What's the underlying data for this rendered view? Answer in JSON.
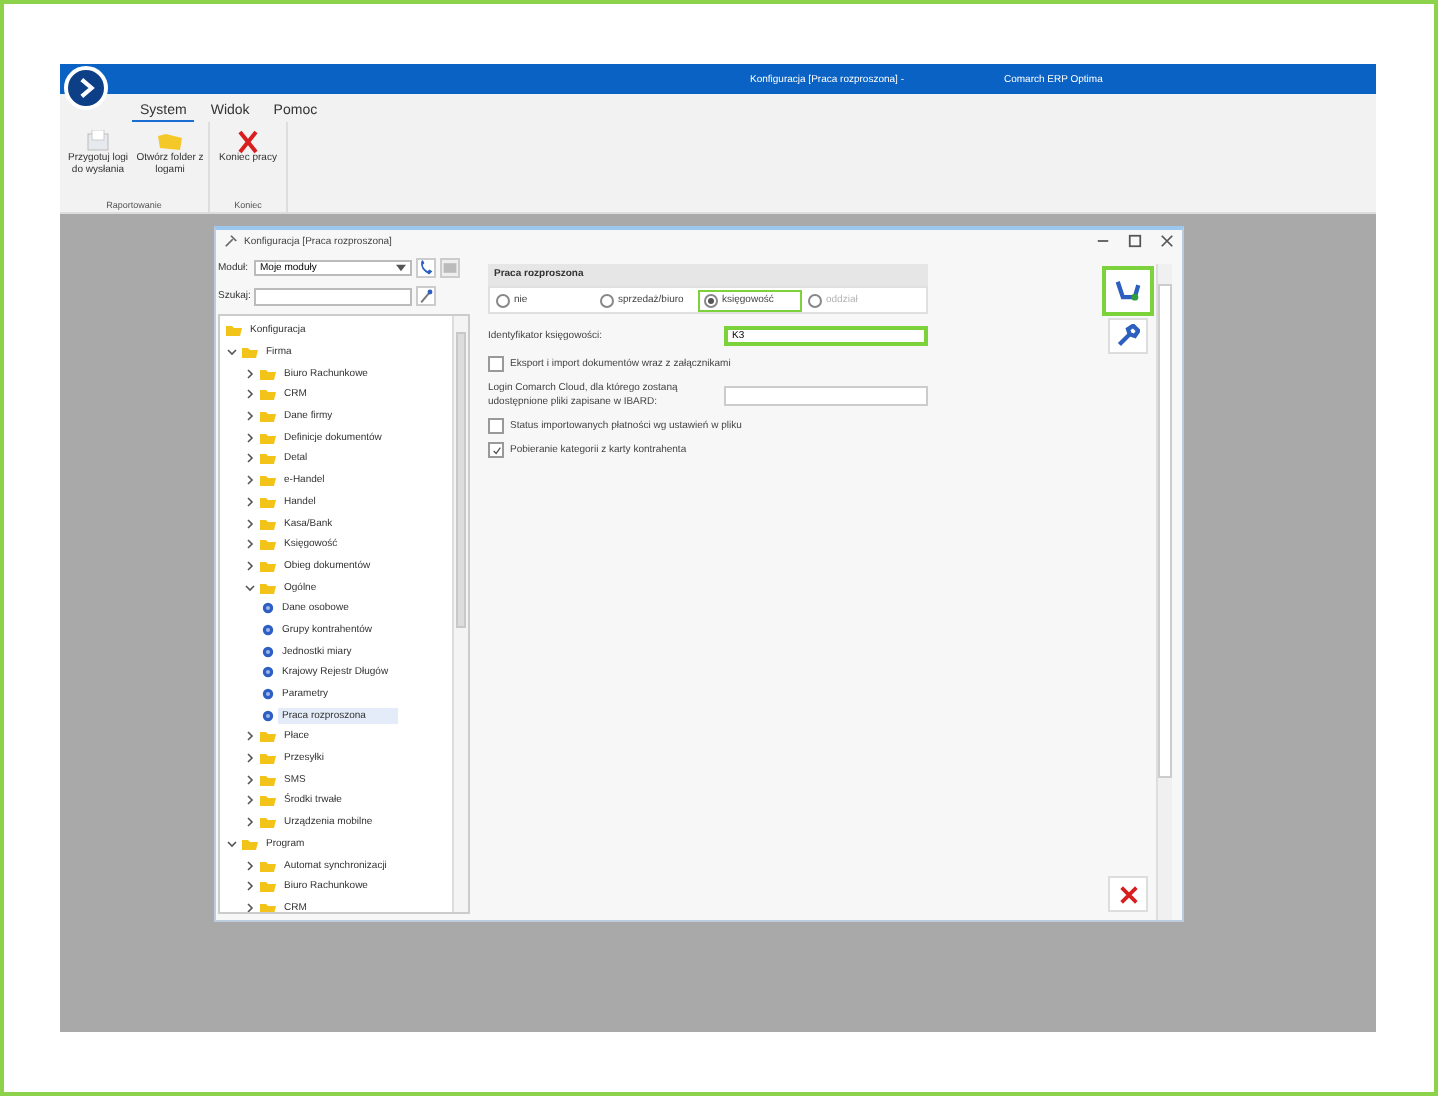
{
  "app_window": {
    "title": "Konfiguracja [Praca rozproszona] -",
    "app_name": "Comarch ERP Optima"
  },
  "ribbon": {
    "tabs": [
      {
        "label": "System",
        "selected": true
      },
      {
        "label": "Widok",
        "selected": false
      },
      {
        "label": "Pomoc",
        "selected": false
      }
    ],
    "groups": [
      {
        "label": "Raportowanie",
        "buttons": [
          {
            "label": "Przygotuj logi do wysłania",
            "kind": "logs"
          },
          {
            "label": "Otwórz folder z logami",
            "kind": "folder"
          }
        ]
      },
      {
        "label": "Koniec",
        "buttons": [
          {
            "label": "Koniec pracy",
            "kind": "exit"
          }
        ]
      }
    ]
  },
  "dialog": {
    "title": "Konfiguracja [Praca rozproszona]",
    "module_label": "Moduł:",
    "module_value": "Moje moduły",
    "search_label": "Szukaj:",
    "tree": [
      {
        "label": "Konfiguracja",
        "kind": "folder",
        "selected": false
      },
      {
        "label": "Firma",
        "kind": "folder",
        "expanded": true,
        "selected": false,
        "children": [
          {
            "label": "Biuro Rachunkowe",
            "kind": "folder",
            "expanded": false,
            "selected": false
          },
          {
            "label": "CRM",
            "kind": "folder",
            "expanded": false,
            "selected": false
          },
          {
            "label": "Dane firmy",
            "kind": "folder",
            "expanded": false,
            "selected": false
          },
          {
            "label": "Definicje dokumentów",
            "kind": "folder",
            "expanded": false,
            "selected": false
          },
          {
            "label": "Detal",
            "kind": "folder",
            "expanded": false,
            "selected": false
          },
          {
            "label": "e-Handel",
            "kind": "folder",
            "expanded": false,
            "selected": false
          },
          {
            "label": "Handel",
            "kind": "folder",
            "expanded": false,
            "selected": false
          },
          {
            "label": "Kasa/Bank",
            "kind": "folder",
            "expanded": false,
            "selected": false
          },
          {
            "label": "Księgowość",
            "kind": "folder",
            "expanded": false,
            "selected": false
          },
          {
            "label": "Obieg dokumentów",
            "kind": "folder",
            "expanded": false,
            "selected": false
          },
          {
            "label": "Ogólne",
            "kind": "folder",
            "expanded": true,
            "selected": false,
            "children": [
              {
                "label": "Dane osobowe",
                "kind": "setting",
                "selected": false
              },
              {
                "label": "Grupy kontrahentów",
                "kind": "setting",
                "selected": false
              },
              {
                "label": "Jednostki miary",
                "kind": "setting",
                "selected": false
              },
              {
                "label": "Krajowy Rejestr Długów",
                "kind": "setting",
                "selected": false
              },
              {
                "label": "Parametry",
                "kind": "setting",
                "selected": false
              },
              {
                "label": "Praca rozproszona",
                "kind": "setting",
                "selected": true
              }
            ]
          },
          {
            "label": "Płace",
            "kind": "folder",
            "expanded": false,
            "selected": false
          },
          {
            "label": "Przesyłki",
            "kind": "folder",
            "expanded": false,
            "selected": false
          },
          {
            "label": "SMS",
            "kind": "folder",
            "expanded": false,
            "selected": false
          },
          {
            "label": "Środki trwałe",
            "kind": "folder",
            "expanded": false,
            "selected": false
          },
          {
            "label": "Urządzenia mobilne",
            "kind": "folder",
            "expanded": false,
            "selected": false
          }
        ]
      },
      {
        "label": "Program",
        "kind": "folder",
        "expanded": true,
        "selected": false,
        "children": [
          {
            "label": "Automat synchronizacji",
            "kind": "folder",
            "expanded": false,
            "selected": false
          },
          {
            "label": "Biuro Rachunkowe",
            "kind": "folder",
            "expanded": false,
            "selected": false
          },
          {
            "label": "CRM",
            "kind": "folder",
            "expanded": false,
            "selected": false
          }
        ]
      }
    ],
    "section_title": "Praca rozproszona",
    "radios": [
      {
        "label": "nie",
        "selected": false,
        "disabled": false,
        "highlighted": false
      },
      {
        "label": "sprzedaż/biuro",
        "selected": false,
        "disabled": false,
        "highlighted": false
      },
      {
        "label": "księgowość",
        "selected": true,
        "disabled": false,
        "highlighted": true
      },
      {
        "label": "oddział",
        "selected": false,
        "disabled": true,
        "highlighted": false
      }
    ],
    "fields": [
      {
        "kind": "text",
        "label": "Identyfikator księgowości:",
        "value": "K3",
        "highlighted": true
      },
      {
        "kind": "checkbox",
        "label": "Eksport i import dokumentów wraz z załącznikami",
        "checked": false
      },
      {
        "kind": "text",
        "label": "Login Comarch Cloud, dla którego zostaną udostępnione pliki zapisane w IBARD:",
        "highlighted": false
      },
      {
        "kind": "checkbox",
        "label": "Status importowanych płatności wg ustawień w pliku",
        "checked": false
      },
      {
        "kind": "checkbox",
        "label": "Pobieranie kategorii z karty kontrahenta",
        "checked": true
      }
    ],
    "save_highlighted": true
  }
}
